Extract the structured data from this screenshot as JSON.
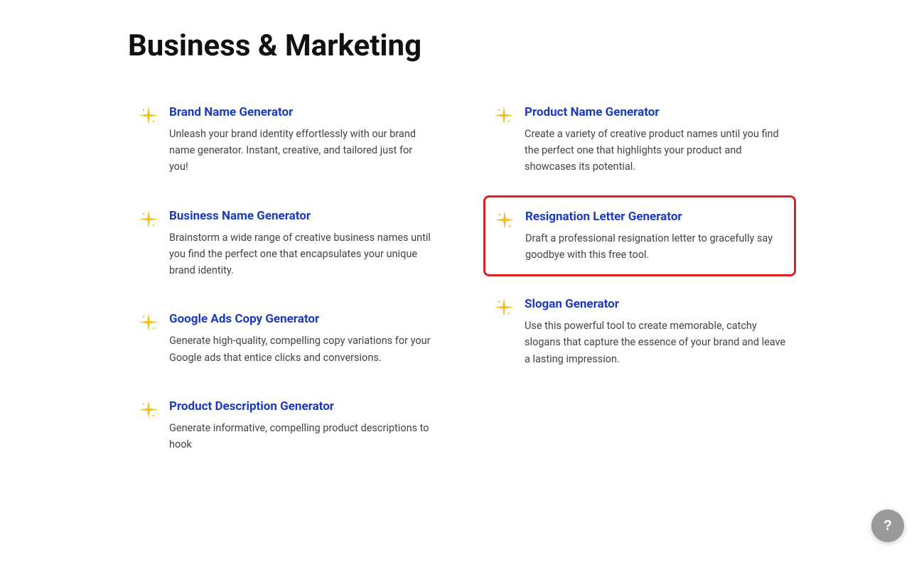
{
  "page": {
    "title": "Business & Marketing"
  },
  "cards": [
    {
      "id": "brand-name-generator",
      "title": "Brand Name Generator",
      "description": "Unleash your brand identity effortlessly with our brand name generator. Instant, creative, and tailored just for you!",
      "highlighted": false,
      "column": "left"
    },
    {
      "id": "business-name-generator",
      "title": "Business Name Generator",
      "description": "Brainstorm a wide range of creative business names until you find the perfect one that encapsulates your unique brand identity.",
      "highlighted": false,
      "column": "left"
    },
    {
      "id": "google-ads-copy-generator",
      "title": "Google Ads Copy Generator",
      "description": "Generate high-quality, compelling copy variations for your Google ads that entice clicks and conversions.",
      "highlighted": false,
      "column": "left"
    },
    {
      "id": "product-description-generator",
      "title": "Product Description Generator",
      "description": "Generate informative, compelling product descriptions to hook",
      "highlighted": false,
      "column": "left"
    },
    {
      "id": "product-name-generator",
      "title": "Product Name Generator",
      "description": "Create a variety of creative product names until you find the perfect one that highlights your product and showcases its potential.",
      "highlighted": false,
      "column": "right"
    },
    {
      "id": "resignation-letter-generator",
      "title": "Resignation Letter Generator",
      "description": "Draft a professional resignation letter to gracefully say goodbye with this free tool.",
      "highlighted": true,
      "column": "right"
    },
    {
      "id": "slogan-generator",
      "title": "Slogan Generator",
      "description": "Use this powerful tool to create memorable, catchy slogans that capture the essence of your brand and leave a lasting impression.",
      "highlighted": false,
      "column": "right"
    }
  ],
  "help_button": {
    "label": "?"
  }
}
